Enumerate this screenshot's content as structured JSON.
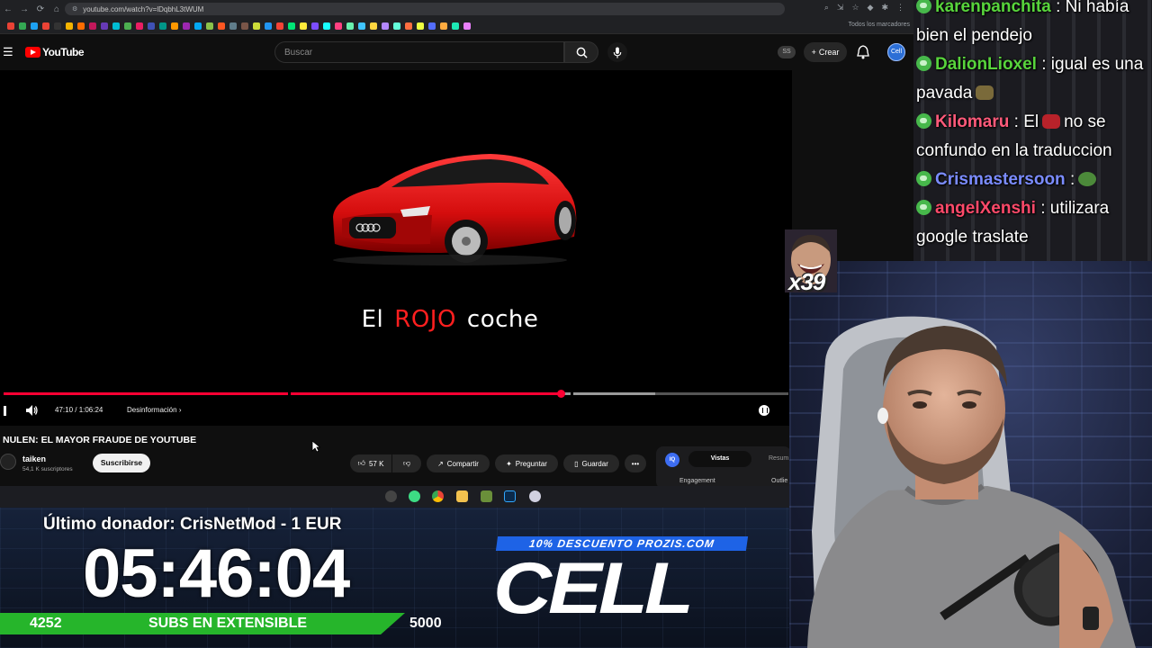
{
  "browser": {
    "url": "youtube.com/watch?v=lDqbhL3tWUM",
    "bookmarks_all": "Todos los marcadores",
    "bookmark_colors": [
      "#e94235",
      "#34a853",
      "#1da1f2",
      "#ea4335",
      "#333",
      "#f4b400",
      "#ff6d00",
      "#c2185b",
      "#673ab7",
      "#00bcd4",
      "#4caf50",
      "#e91e63",
      "#3f51b5",
      "#009688",
      "#ff9800",
      "#9c27b0",
      "#03a9f4",
      "#8bc34a",
      "#ff5722",
      "#607d8b",
      "#795548",
      "#cddc39",
      "#2196f3",
      "#f44336",
      "#00e676",
      "#ffeb3b",
      "#7c4dff",
      "#18ffff",
      "#ff4081",
      "#69f0ae",
      "#40c4ff",
      "#ffd740",
      "#b388ff",
      "#64ffda",
      "#ff6e40",
      "#eeff41",
      "#536dfe",
      "#ffab40",
      "#1de9b6",
      "#ea80fc"
    ]
  },
  "youtube": {
    "logo_text": "YouTube",
    "search_placeholder": "Buscar",
    "badge": "SS",
    "create_label": "Crear",
    "avatar_label": "Cell"
  },
  "video": {
    "caption_w1": "El",
    "caption_w2": "ROJO",
    "caption_w3": "coche",
    "time": "47:10 / 1:06:24",
    "chapter": "Desinformación",
    "progress_fraction": 0.71,
    "buffer_fraction": 0.83,
    "title": "NULEN: EL MAYOR FRAUDE DE YOUTUBE",
    "channel": "taiken",
    "subscribers": "54,1 K suscriptores",
    "subscribe_label": "Suscribirse",
    "likes": "57 K",
    "share_label": "Compartir",
    "ask_label": "Preguntar",
    "save_label": "Guardar",
    "stats_tab_active": "Vistas",
    "stats_tab_other": "Resum",
    "stats_key1": "Engagement",
    "stats_key2": "Outlie"
  },
  "overlay": {
    "donor": "Último donador: CrisNetMod - 1 EUR",
    "timer": "05:46:04",
    "subs_current": "4252",
    "subs_label": "SUBS EN EXTENSIBLE",
    "subs_goal": "5000",
    "promo": "10% DESCUENTO PROZIS.COM",
    "brand": "CELL"
  },
  "chat": {
    "messages": [
      {
        "user": "karenpanchita",
        "color": "#58d43c",
        "text": " : Ni había bien el pendejo"
      },
      {
        "user": "DalionLioxel",
        "color": "#58d43c",
        "text": " : igual es una pavada"
      },
      {
        "user": "Kilomaru",
        "color": "#ff5a7a",
        "text": " : El",
        "text2": "no se confundo en la traduccion"
      },
      {
        "user": "Crismastersoon",
        "color": "#7b8cff",
        "text": " :"
      },
      {
        "user": "angelXenshi",
        "color": "#ff4a6a",
        "text": " : utilizara google traslate"
      }
    ]
  },
  "stream": {
    "emote_multiplier": "x39"
  }
}
